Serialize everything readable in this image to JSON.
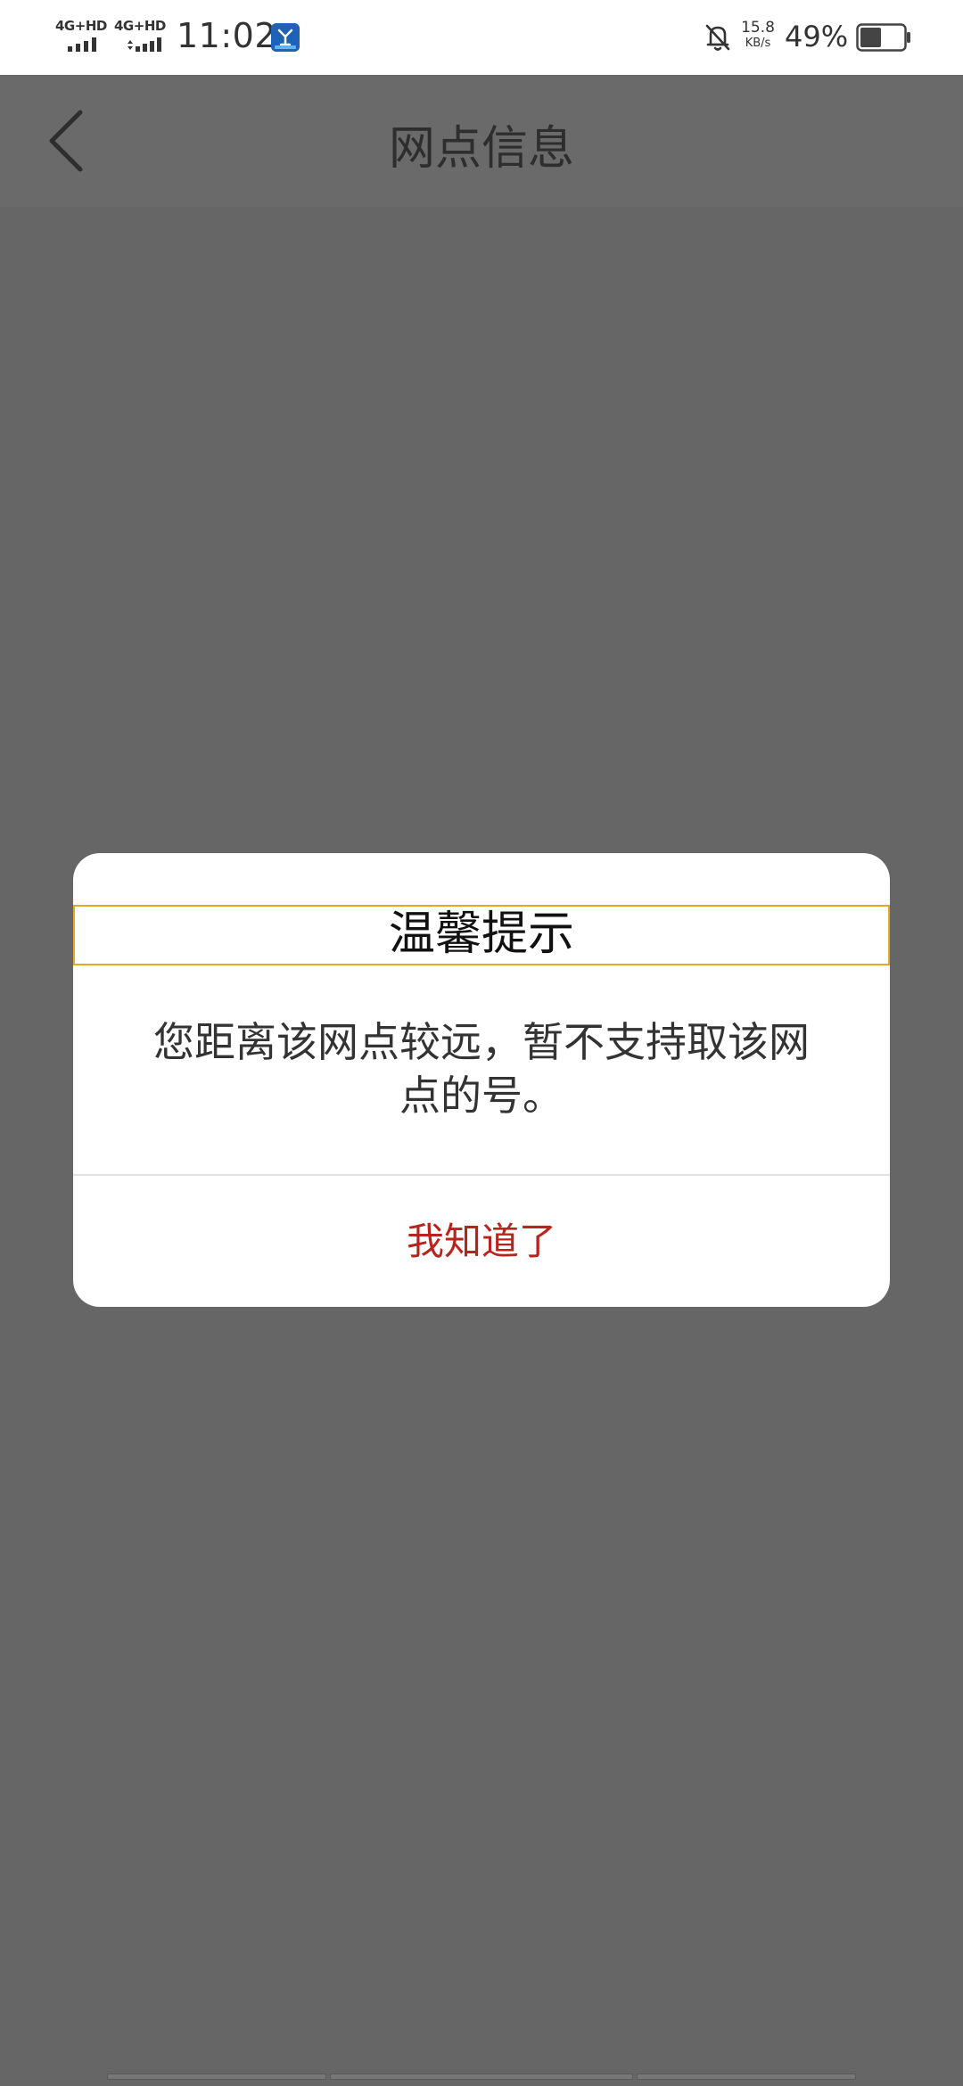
{
  "status_bar": {
    "network_1": "4G+HD",
    "network_2": "4G+HD",
    "time": "11:02",
    "app_icon": "app-logo-icon",
    "alert_icon": "bell-off-icon",
    "net_speed_value": "15.8",
    "net_speed_unit": "KB/s",
    "battery_percent": "49%",
    "battery_level": 0.49
  },
  "header": {
    "back_icon": "chevron-left-icon",
    "title": "网点信息"
  },
  "dialog": {
    "title": "温馨提示",
    "message": "您距离该网点较远，暂不支持取该网点的号。",
    "confirm_label": "我知道了",
    "title_border_color": "#e9a62a",
    "confirm_color": "#b8231b"
  },
  "colors": {
    "overlay": "#666666",
    "status_bar_bg": "#ffffff",
    "dialog_bg": "#ffffff"
  }
}
